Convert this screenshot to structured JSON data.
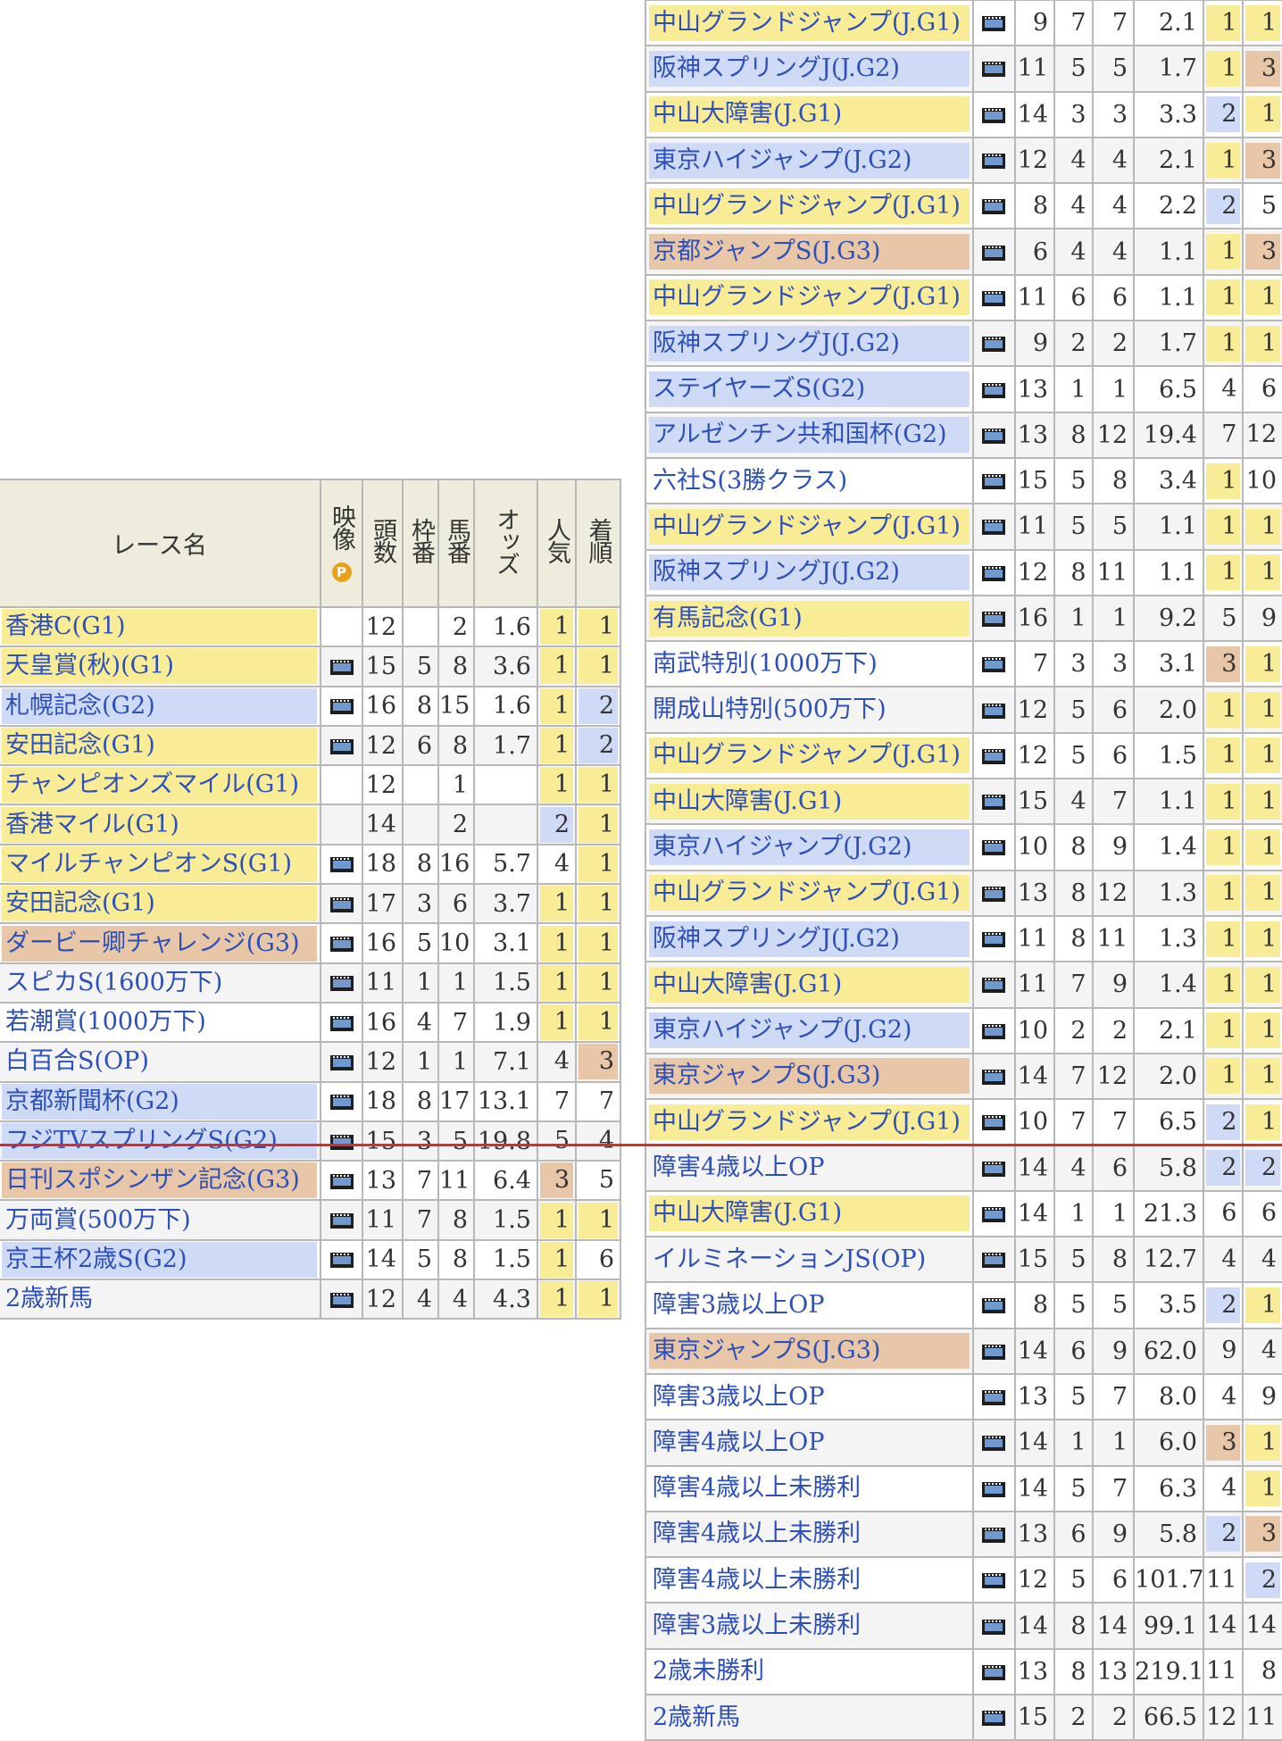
{
  "left_table": {
    "headers": {
      "race": "レース名",
      "video": "映像",
      "video_badge": "P",
      "runners": "頭数",
      "frame": "枠番",
      "horse": "馬番",
      "odds": "オッズ",
      "popularity": "人気",
      "finish": "着順"
    },
    "rows": [
      {
        "race": "香港C(G1)",
        "grade": "g1",
        "video": false,
        "runners": "12",
        "frame": "",
        "horse": "2",
        "odds": "1.6",
        "pop": "1",
        "fin": "1"
      },
      {
        "race": "天皇賞(秋)(G1)",
        "grade": "g1",
        "video": true,
        "runners": "15",
        "frame": "5",
        "horse": "8",
        "odds": "3.6",
        "pop": "1",
        "fin": "1"
      },
      {
        "race": "札幌記念(G2)",
        "grade": "g2",
        "video": true,
        "runners": "16",
        "frame": "8",
        "horse": "15",
        "odds": "1.6",
        "pop": "1",
        "fin": "2"
      },
      {
        "race": "安田記念(G1)",
        "grade": "g1",
        "video": true,
        "runners": "12",
        "frame": "6",
        "horse": "8",
        "odds": "1.7",
        "pop": "1",
        "fin": "2"
      },
      {
        "race": "チャンピオンズマイル(G1)",
        "grade": "g1",
        "video": false,
        "runners": "12",
        "frame": "",
        "horse": "1",
        "odds": "",
        "pop": "1",
        "fin": "1"
      },
      {
        "race": "香港マイル(G1)",
        "grade": "g1",
        "video": false,
        "runners": "14",
        "frame": "",
        "horse": "2",
        "odds": "",
        "pop": "2",
        "fin": "1"
      },
      {
        "race": "マイルチャンピオンS(G1)",
        "grade": "g1",
        "video": true,
        "runners": "18",
        "frame": "8",
        "horse": "16",
        "odds": "5.7",
        "pop": "4",
        "fin": "1"
      },
      {
        "race": "安田記念(G1)",
        "grade": "g1",
        "video": true,
        "runners": "17",
        "frame": "3",
        "horse": "6",
        "odds": "3.7",
        "pop": "1",
        "fin": "1"
      },
      {
        "race": "ダービー卿チャレンジ(G3)",
        "grade": "g3",
        "video": true,
        "runners": "16",
        "frame": "5",
        "horse": "10",
        "odds": "3.1",
        "pop": "1",
        "fin": "1"
      },
      {
        "race": "スピカS(1600万下)",
        "grade": "op",
        "video": true,
        "runners": "11",
        "frame": "1",
        "horse": "1",
        "odds": "1.5",
        "pop": "1",
        "fin": "1"
      },
      {
        "race": "若潮賞(1000万下)",
        "grade": "op",
        "video": true,
        "runners": "16",
        "frame": "4",
        "horse": "7",
        "odds": "1.9",
        "pop": "1",
        "fin": "1"
      },
      {
        "race": "白百合S(OP)",
        "grade": "op",
        "video": true,
        "runners": "12",
        "frame": "1",
        "horse": "1",
        "odds": "7.1",
        "pop": "4",
        "fin": "3"
      },
      {
        "race": "京都新聞杯(G2)",
        "grade": "g2",
        "video": true,
        "runners": "18",
        "frame": "8",
        "horse": "17",
        "odds": "13.1",
        "pop": "7",
        "fin": "7"
      },
      {
        "race": "フジTVスプリングS(G2)",
        "grade": "g2",
        "video": true,
        "runners": "15",
        "frame": "3",
        "horse": "5",
        "odds": "19.8",
        "pop": "5",
        "fin": "4"
      },
      {
        "race": "日刊スポシンザン記念(G3)",
        "grade": "g3",
        "video": true,
        "runners": "13",
        "frame": "7",
        "horse": "11",
        "odds": "6.4",
        "pop": "3",
        "fin": "5"
      },
      {
        "race": "万両賞(500万下)",
        "grade": "op",
        "video": true,
        "runners": "11",
        "frame": "7",
        "horse": "8",
        "odds": "1.5",
        "pop": "1",
        "fin": "1"
      },
      {
        "race": "京王杯2歳S(G2)",
        "grade": "g2",
        "video": true,
        "runners": "14",
        "frame": "5",
        "horse": "8",
        "odds": "1.5",
        "pop": "1",
        "fin": "6"
      },
      {
        "race": "2歳新馬",
        "grade": "op",
        "video": true,
        "runners": "12",
        "frame": "4",
        "horse": "4",
        "odds": "4.3",
        "pop": "1",
        "fin": "1"
      }
    ]
  },
  "right_table": {
    "rows": [
      {
        "race": "中山グランドジャンプ(J.G1)",
        "grade": "g1",
        "video": true,
        "runners": "9",
        "frame": "7",
        "horse": "7",
        "odds": "2.1",
        "pop": "1",
        "fin": "1"
      },
      {
        "race": "阪神スプリングJ(J.G2)",
        "grade": "g2",
        "video": true,
        "runners": "11",
        "frame": "5",
        "horse": "5",
        "odds": "1.7",
        "pop": "1",
        "fin": "3"
      },
      {
        "race": "中山大障害(J.G1)",
        "grade": "g1",
        "video": true,
        "runners": "14",
        "frame": "3",
        "horse": "3",
        "odds": "3.3",
        "pop": "2",
        "fin": "1"
      },
      {
        "race": "東京ハイジャンプ(J.G2)",
        "grade": "g2",
        "video": true,
        "runners": "12",
        "frame": "4",
        "horse": "4",
        "odds": "2.1",
        "pop": "1",
        "fin": "3"
      },
      {
        "race": "中山グランドジャンプ(J.G1)",
        "grade": "g1",
        "video": true,
        "runners": "8",
        "frame": "4",
        "horse": "4",
        "odds": "2.2",
        "pop": "2",
        "fin": "5"
      },
      {
        "race": "京都ジャンプS(J.G3)",
        "grade": "g3",
        "video": true,
        "runners": "6",
        "frame": "4",
        "horse": "4",
        "odds": "1.1",
        "pop": "1",
        "fin": "3"
      },
      {
        "race": "中山グランドジャンプ(J.G1)",
        "grade": "g1",
        "video": true,
        "runners": "11",
        "frame": "6",
        "horse": "6",
        "odds": "1.1",
        "pop": "1",
        "fin": "1"
      },
      {
        "race": "阪神スプリングJ(J.G2)",
        "grade": "g2",
        "video": true,
        "runners": "9",
        "frame": "2",
        "horse": "2",
        "odds": "1.7",
        "pop": "1",
        "fin": "1"
      },
      {
        "race": "ステイヤーズS(G2)",
        "grade": "g2",
        "video": true,
        "runners": "13",
        "frame": "1",
        "horse": "1",
        "odds": "6.5",
        "pop": "4",
        "fin": "6"
      },
      {
        "race": "アルゼンチン共和国杯(G2)",
        "grade": "g2",
        "video": true,
        "runners": "13",
        "frame": "8",
        "horse": "12",
        "odds": "19.4",
        "pop": "7",
        "fin": "12"
      },
      {
        "race": "六社S(3勝クラス)",
        "grade": "op",
        "video": true,
        "runners": "15",
        "frame": "5",
        "horse": "8",
        "odds": "3.4",
        "pop": "1",
        "fin": "10"
      },
      {
        "race": "中山グランドジャンプ(J.G1)",
        "grade": "g1",
        "video": true,
        "runners": "11",
        "frame": "5",
        "horse": "5",
        "odds": "1.1",
        "pop": "1",
        "fin": "1"
      },
      {
        "race": "阪神スプリングJ(J.G2)",
        "grade": "g2",
        "video": true,
        "runners": "12",
        "frame": "8",
        "horse": "11",
        "odds": "1.1",
        "pop": "1",
        "fin": "1"
      },
      {
        "race": "有馬記念(G1)",
        "grade": "g1",
        "video": true,
        "runners": "16",
        "frame": "1",
        "horse": "1",
        "odds": "9.2",
        "pop": "5",
        "fin": "9"
      },
      {
        "race": "南武特別(1000万下)",
        "grade": "op",
        "video": true,
        "runners": "7",
        "frame": "3",
        "horse": "3",
        "odds": "3.1",
        "pop": "3",
        "fin": "1"
      },
      {
        "race": "開成山特別(500万下)",
        "grade": "op",
        "video": true,
        "runners": "12",
        "frame": "5",
        "horse": "6",
        "odds": "2.0",
        "pop": "1",
        "fin": "1"
      },
      {
        "race": "中山グランドジャンプ(J.G1)",
        "grade": "g1",
        "video": true,
        "runners": "12",
        "frame": "5",
        "horse": "6",
        "odds": "1.5",
        "pop": "1",
        "fin": "1"
      },
      {
        "race": "中山大障害(J.G1)",
        "grade": "g1",
        "video": true,
        "runners": "15",
        "frame": "4",
        "horse": "7",
        "odds": "1.1",
        "pop": "1",
        "fin": "1"
      },
      {
        "race": "東京ハイジャンプ(J.G2)",
        "grade": "g2",
        "video": true,
        "runners": "10",
        "frame": "8",
        "horse": "9",
        "odds": "1.4",
        "pop": "1",
        "fin": "1"
      },
      {
        "race": "中山グランドジャンプ(J.G1)",
        "grade": "g1",
        "video": true,
        "runners": "13",
        "frame": "8",
        "horse": "12",
        "odds": "1.3",
        "pop": "1",
        "fin": "1"
      },
      {
        "race": "阪神スプリングJ(J.G2)",
        "grade": "g2",
        "video": true,
        "runners": "11",
        "frame": "8",
        "horse": "11",
        "odds": "1.3",
        "pop": "1",
        "fin": "1"
      },
      {
        "race": "中山大障害(J.G1)",
        "grade": "g1",
        "video": true,
        "runners": "11",
        "frame": "7",
        "horse": "9",
        "odds": "1.4",
        "pop": "1",
        "fin": "1"
      },
      {
        "race": "東京ハイジャンプ(J.G2)",
        "grade": "g2",
        "video": true,
        "runners": "10",
        "frame": "2",
        "horse": "2",
        "odds": "2.1",
        "pop": "1",
        "fin": "1"
      },
      {
        "race": "東京ジャンプS(J.G3)",
        "grade": "g3",
        "video": true,
        "runners": "14",
        "frame": "7",
        "horse": "12",
        "odds": "2.0",
        "pop": "1",
        "fin": "1"
      },
      {
        "race": "中山グランドジャンプ(J.G1)",
        "grade": "g1",
        "video": true,
        "runners": "10",
        "frame": "7",
        "horse": "7",
        "odds": "6.5",
        "pop": "2",
        "fin": "1"
      },
      {
        "race": "障害4歳以上OP",
        "grade": "op",
        "video": true,
        "runners": "14",
        "frame": "4",
        "horse": "6",
        "odds": "5.8",
        "pop": "2",
        "fin": "2"
      },
      {
        "race": "中山大障害(J.G1)",
        "grade": "g1",
        "video": true,
        "runners": "14",
        "frame": "1",
        "horse": "1",
        "odds": "21.3",
        "pop": "6",
        "fin": "6"
      },
      {
        "race": "イルミネーションJS(OP)",
        "grade": "op",
        "video": true,
        "runners": "15",
        "frame": "5",
        "horse": "8",
        "odds": "12.7",
        "pop": "4",
        "fin": "4"
      },
      {
        "race": "障害3歳以上OP",
        "grade": "op",
        "video": true,
        "runners": "8",
        "frame": "5",
        "horse": "5",
        "odds": "3.5",
        "pop": "2",
        "fin": "1"
      },
      {
        "race": "東京ジャンプS(J.G3)",
        "grade": "g3",
        "video": true,
        "runners": "14",
        "frame": "6",
        "horse": "9",
        "odds": "62.0",
        "pop": "9",
        "fin": "4"
      },
      {
        "race": "障害3歳以上OP",
        "grade": "op",
        "video": true,
        "runners": "13",
        "frame": "5",
        "horse": "7",
        "odds": "8.0",
        "pop": "4",
        "fin": "9"
      },
      {
        "race": "障害4歳以上OP",
        "grade": "op",
        "video": true,
        "runners": "14",
        "frame": "1",
        "horse": "1",
        "odds": "6.0",
        "pop": "3",
        "fin": "1"
      },
      {
        "race": "障害4歳以上未勝利",
        "grade": "op",
        "video": true,
        "runners": "14",
        "frame": "5",
        "horse": "7",
        "odds": "6.3",
        "pop": "4",
        "fin": "1"
      },
      {
        "race": "障害4歳以上未勝利",
        "grade": "op",
        "video": true,
        "runners": "13",
        "frame": "6",
        "horse": "9",
        "odds": "5.8",
        "pop": "2",
        "fin": "3"
      },
      {
        "race": "障害4歳以上未勝利",
        "grade": "op",
        "video": true,
        "runners": "12",
        "frame": "5",
        "horse": "6",
        "odds": "101.7",
        "pop": "11",
        "fin": "2"
      },
      {
        "race": "障害3歳以上未勝利",
        "grade": "op",
        "video": true,
        "runners": "14",
        "frame": "8",
        "horse": "14",
        "odds": "99.1",
        "pop": "14",
        "fin": "14"
      },
      {
        "race": "2歳未勝利",
        "grade": "op",
        "video": true,
        "runners": "13",
        "frame": "8",
        "horse": "13",
        "odds": "219.1",
        "pop": "11",
        "fin": "8"
      },
      {
        "race": "2歳新馬",
        "grade": "op",
        "video": true,
        "runners": "15",
        "frame": "2",
        "horse": "2",
        "odds": "66.5",
        "pop": "12",
        "fin": "11"
      }
    ]
  },
  "colors": {
    "g1": "#f9ec97",
    "g2": "#cfdbf6",
    "g3": "#e8c7a8",
    "divider": "#d42e2e",
    "link": "#2d4fb8"
  }
}
